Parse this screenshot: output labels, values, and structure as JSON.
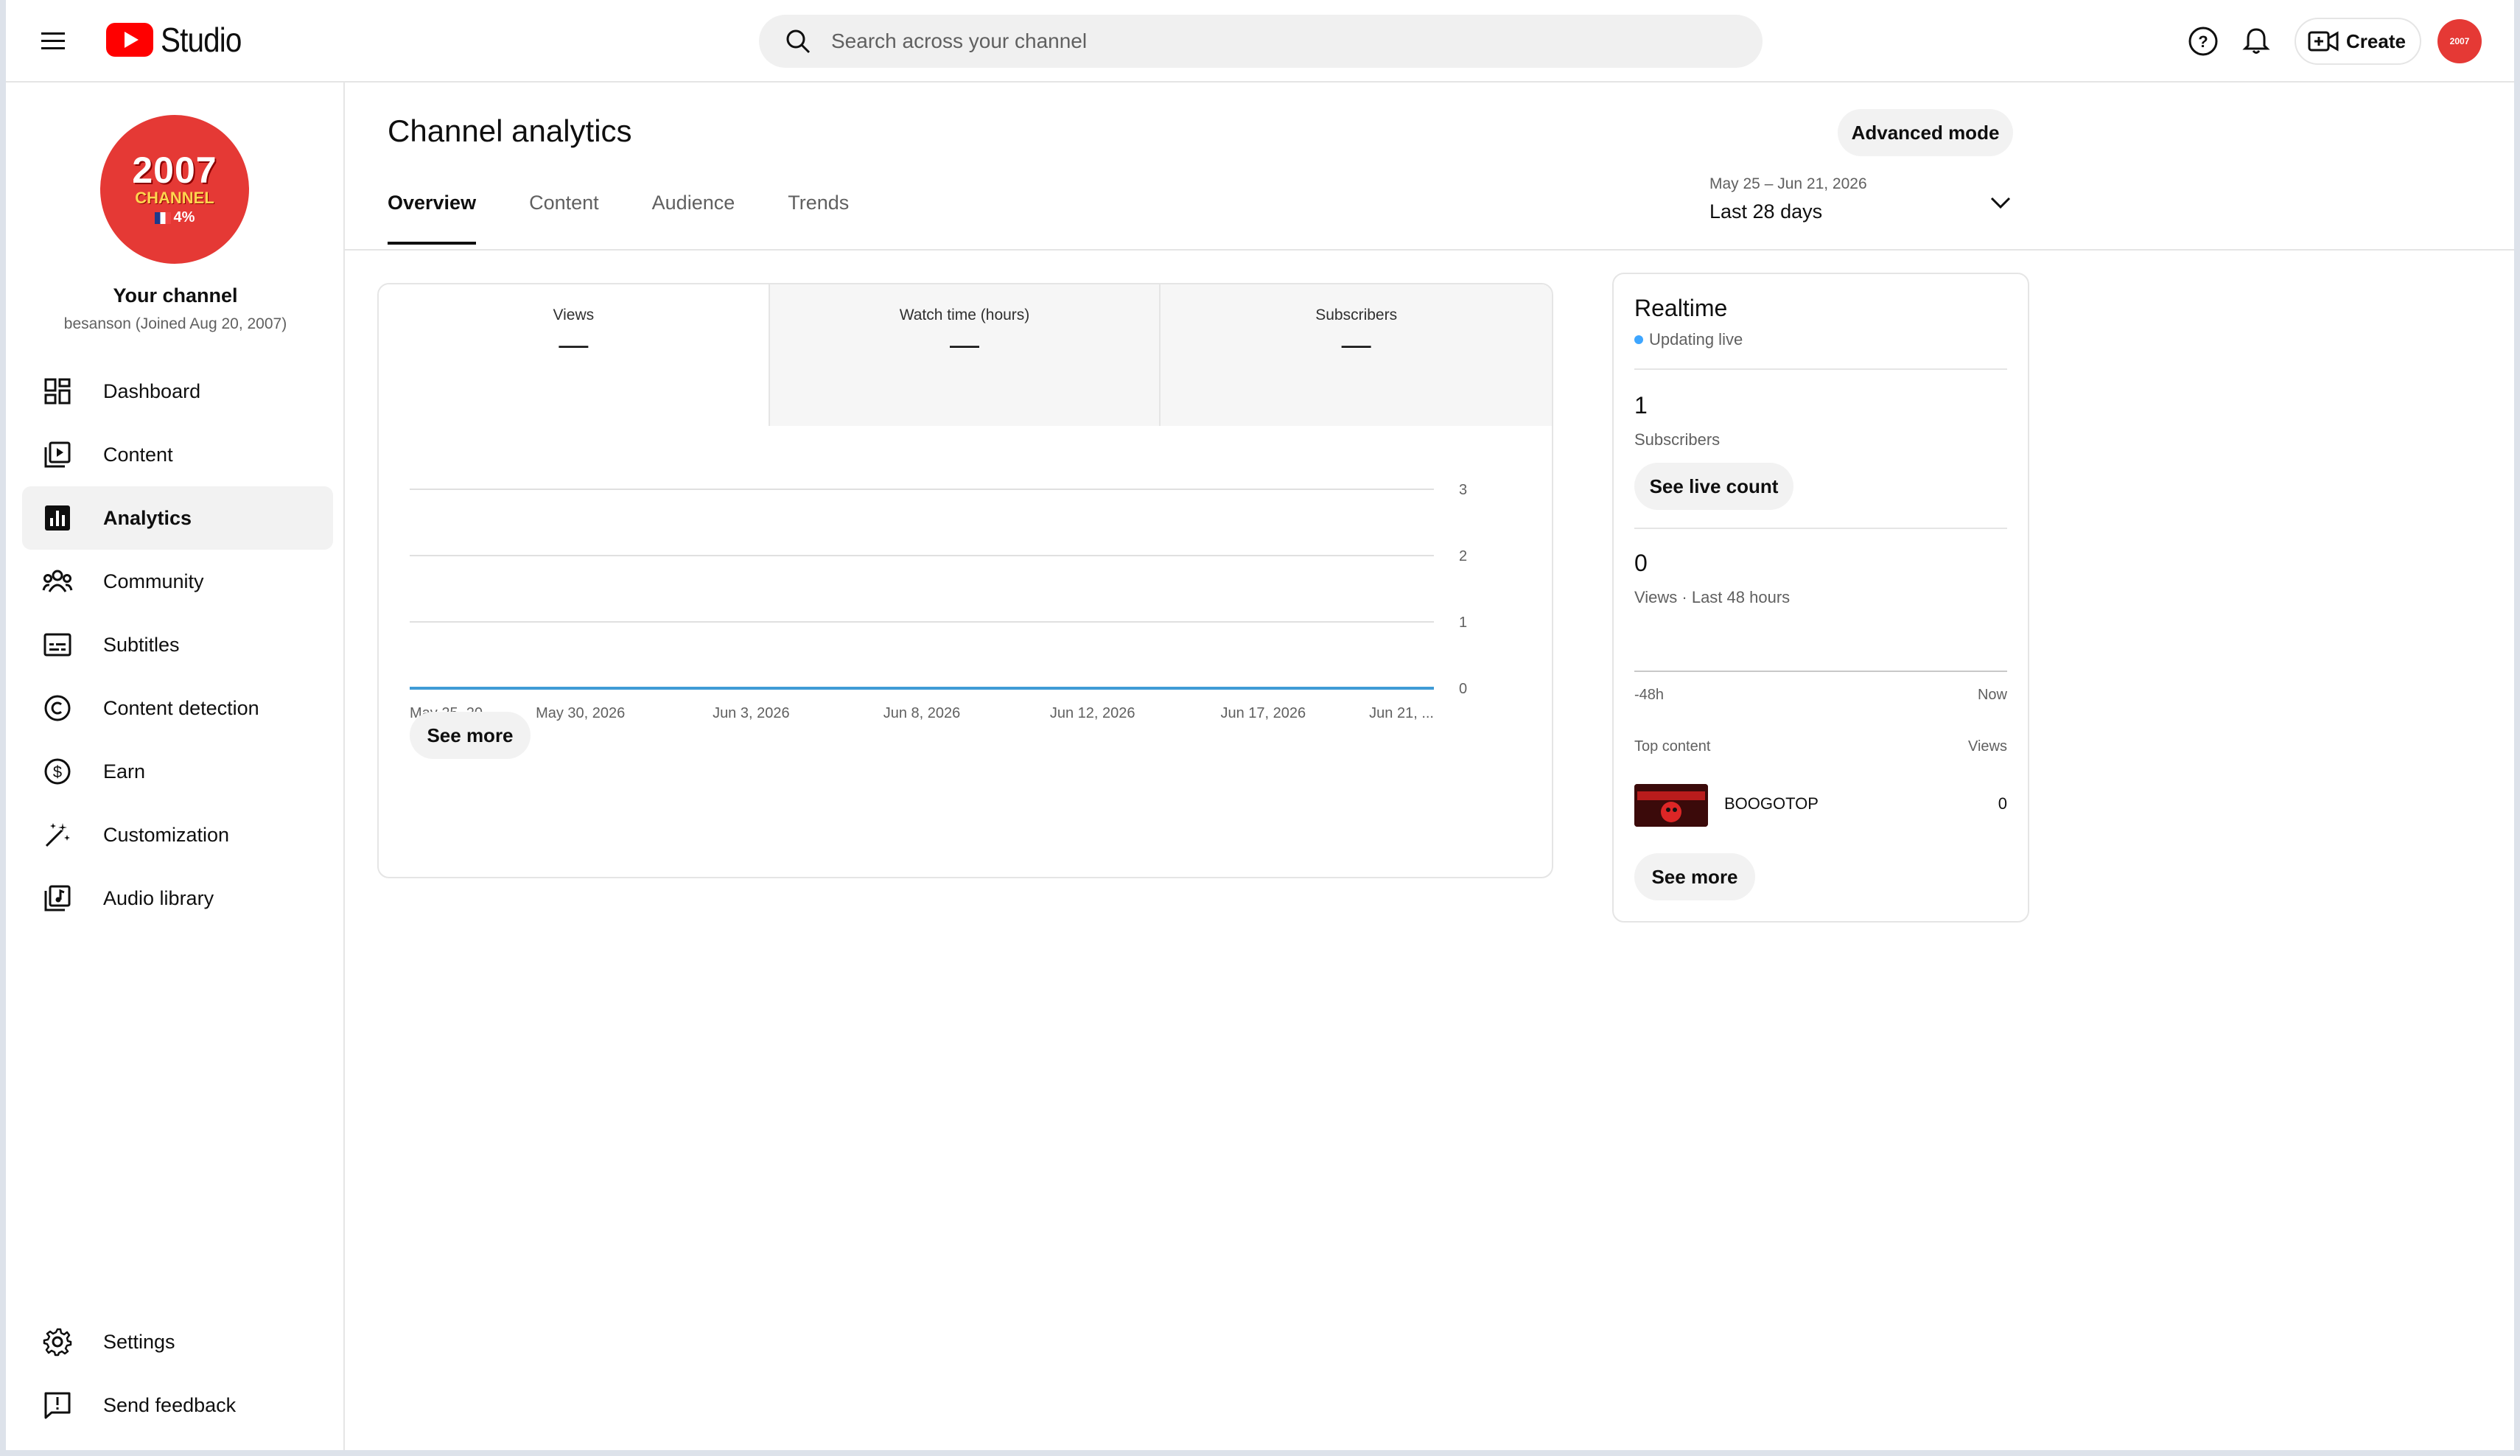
{
  "header": {
    "app_name": "Studio",
    "search_placeholder": "Search across your channel",
    "create_label": "Create",
    "avatar_text": "2007"
  },
  "sidebar": {
    "avatar": {
      "line1": "2007",
      "line2": "CHANNEL",
      "line3": "4%"
    },
    "channel_name": "Your channel",
    "channel_sub": "besanson (Joined Aug 20, 2007)",
    "items": [
      {
        "label": "Dashboard",
        "icon": "dashboard-icon"
      },
      {
        "label": "Content",
        "icon": "content-icon"
      },
      {
        "label": "Analytics",
        "icon": "analytics-icon",
        "active": true
      },
      {
        "label": "Community",
        "icon": "community-icon"
      },
      {
        "label": "Subtitles",
        "icon": "subtitles-icon"
      },
      {
        "label": "Content detection",
        "icon": "copyright-icon"
      },
      {
        "label": "Earn",
        "icon": "dollar-icon"
      },
      {
        "label": "Customization",
        "icon": "magic-wand-icon"
      },
      {
        "label": "Audio library",
        "icon": "audio-library-icon"
      }
    ],
    "bottom_items": [
      {
        "label": "Settings",
        "icon": "gear-icon"
      },
      {
        "label": "Send feedback",
        "icon": "feedback-icon"
      }
    ]
  },
  "main": {
    "title": "Channel analytics",
    "advanced_mode_label": "Advanced mode",
    "tabs": [
      {
        "label": "Overview",
        "active": true
      },
      {
        "label": "Content"
      },
      {
        "label": "Audience"
      },
      {
        "label": "Trends"
      }
    ],
    "date_range": {
      "dates": "May 25 – Jun 21, 2026",
      "label": "Last 28 days"
    },
    "metrics": [
      {
        "label": "Views",
        "value": "—"
      },
      {
        "label": "Watch time (hours)",
        "value": "—"
      },
      {
        "label": "Subscribers",
        "value": "—"
      }
    ],
    "see_more_label": "See more"
  },
  "chart_data": {
    "type": "line",
    "x": [
      "May 25, 20...",
      "May 30, 2026",
      "Jun 3, 2026",
      "Jun 8, 2026",
      "Jun 12, 2026",
      "Jun 17, 2026",
      "Jun 21, ..."
    ],
    "series": [
      {
        "values": [
          0,
          0,
          0,
          0,
          0,
          0,
          0
        ]
      }
    ],
    "ylim": [
      0,
      3
    ],
    "yticks": [
      "3",
      "2",
      "1",
      "0"
    ],
    "grid": true,
    "line_color": "#3f9bd6"
  },
  "realtime": {
    "title": "Realtime",
    "status": "Updating live",
    "subscribers_value": "1",
    "subscribers_label": "Subscribers",
    "see_live_count_label": "See live count",
    "views_value": "0",
    "views_label": "Views · Last 48 hours",
    "axis_start": "-48h",
    "axis_end": "Now",
    "top_content_label": "Top content",
    "views_col_label": "Views",
    "top_item": {
      "title": "BOOGOTOP",
      "views": "0"
    },
    "see_more_label": "See more"
  }
}
